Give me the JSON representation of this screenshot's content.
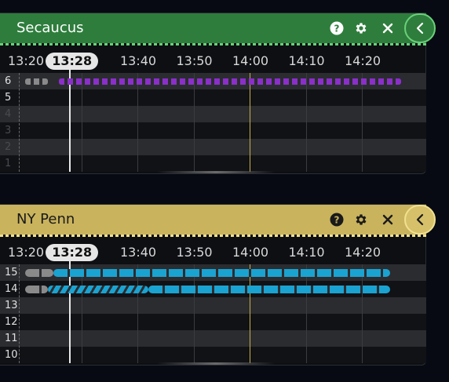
{
  "panels": [
    {
      "title": "Secaucus",
      "theme": {
        "bar": "#2e7d3c",
        "title_color": "#ffffff",
        "icon_color": "#ffffff",
        "collapse_bg": "#2e7d3c",
        "dash": "#6ad07a"
      },
      "axis": {
        "ticks": [
          "13:20",
          "13:40",
          "13:50",
          "14:00",
          "14:10",
          "14:20"
        ],
        "current": "13:28"
      },
      "rows": [
        "6",
        "5",
        "4",
        "3",
        "2",
        "1"
      ],
      "occupancy": [
        {
          "row": "6",
          "from": "13:20",
          "to": "13:24",
          "state": "departed",
          "color": "#8a8a8a"
        },
        {
          "row": "6",
          "from": "13:26",
          "to": "14:27",
          "state": "scheduled",
          "color": "#8b2fc9"
        }
      ]
    },
    {
      "title": "NY Penn",
      "theme": {
        "bar": "#c9b35d",
        "title_color": "#1a1a1a",
        "icon_color": "#1a1a1a",
        "collapse_bg": "#d6c06a",
        "dash": "#f0e090"
      },
      "axis": {
        "ticks": [
          "13:20",
          "13:40",
          "13:50",
          "14:00",
          "14:10",
          "14:20"
        ],
        "current": "13:28"
      },
      "rows": [
        "15",
        "14",
        "13",
        "12",
        "11",
        "10"
      ],
      "occupancy": [
        {
          "row": "15",
          "from": "13:20",
          "to": "13:25",
          "state": "departed",
          "color": "#8a8a8a"
        },
        {
          "row": "15",
          "from": "13:25",
          "to": "14:25",
          "state": "scheduled",
          "color": "#1aa3d1"
        },
        {
          "row": "14",
          "from": "13:20",
          "to": "13:24",
          "state": "departed",
          "color": "#8a8a8a"
        },
        {
          "row": "14",
          "from": "13:24",
          "to": "13:42",
          "state": "arriving",
          "color": "#1aa3d1"
        },
        {
          "row": "14",
          "from": "13:42",
          "to": "14:25",
          "state": "scheduled",
          "color": "#1aa3d1"
        }
      ]
    }
  ],
  "icons": {
    "help": "help-icon",
    "settings": "gear-icon",
    "close": "close-icon",
    "collapse": "chevron-left-icon"
  }
}
